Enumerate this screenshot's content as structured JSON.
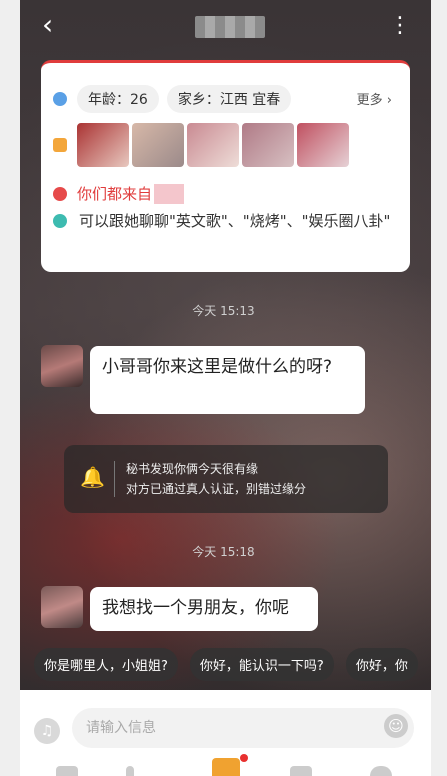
{
  "header": {
    "back_icon": "chevron-left-icon",
    "more_icon": "vertical-dots-icon"
  },
  "profile_card": {
    "age_label": "年龄：26",
    "hometown_label": "家乡：江西 宜春",
    "more_label": "更多",
    "common_label": "你们都来自",
    "topics_text": "可以跟她聊聊\"英文歌\"、\"烧烤\"、\"娱乐圈八卦\""
  },
  "messages": [
    {
      "time": "今天 15:13",
      "text": "小哥哥你来这里是做什么的呀?"
    },
    {
      "time": "今天 15:18",
      "text": "我想找一个男朋友，你呢"
    }
  ],
  "notice": {
    "line1": "秘书发现你俩今天很有缘",
    "line2": "对方已通过真人认证，别错过缘分"
  },
  "suggestions": [
    "你是哪里人，小姐姐?",
    "你好，能认识一下吗?",
    "你好，你"
  ],
  "input": {
    "placeholder": "请输入信息"
  },
  "colors": {
    "accent": "#e03c3c",
    "gift": "#f0a230"
  }
}
